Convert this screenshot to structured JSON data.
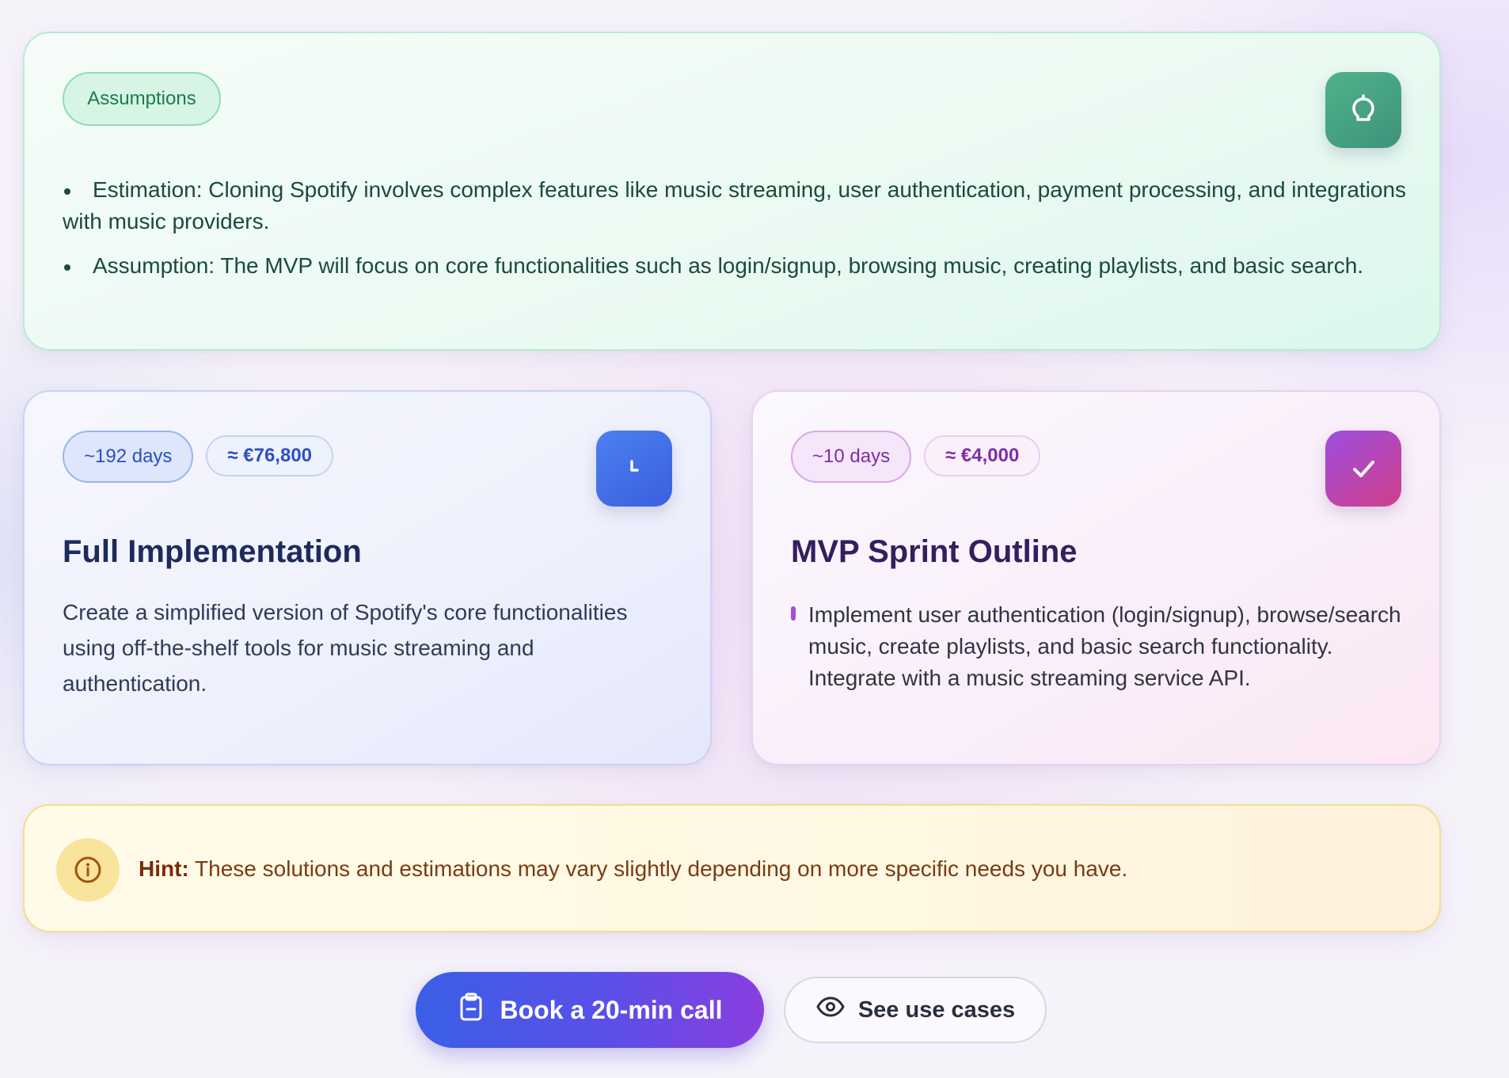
{
  "assumptions": {
    "badge": "Assumptions",
    "icon": "lightbulb-icon",
    "items": [
      "Estimation: Cloning Spotify involves complex features like music streaming, user authentication, payment processing, and integrations with music providers.",
      "Assumption: The MVP will focus on core functionalities such as login/signup, browsing music, creating playlists, and basic search."
    ],
    "accent": "#3e937a"
  },
  "full_implementation": {
    "days": "~192 days",
    "cost": "≈ €76,800",
    "icon": "clock-icon",
    "title": "Full Implementation",
    "description": "Create a simplified version of Spotify's core functionalities using off-the-shelf tools for music streaming and authentication.",
    "accent": "#3a5fdf"
  },
  "mvp_sprint": {
    "days": "~10 days",
    "cost": "≈ €4,000",
    "icon": "check-icon",
    "title": "MVP Sprint Outline",
    "description": "Implement user authentication (login/signup), browse/search music, create playlists, and basic search functionality. Integrate with a music streaming service API.",
    "accent": "#9b4ee0"
  },
  "hint": {
    "label": "Hint:",
    "text": "These solutions and estimations may vary slightly depending on more specific needs you have.",
    "icon": "info-icon"
  },
  "actions": {
    "book_call": "Book a 20-min call",
    "see_use_cases": "See use cases"
  }
}
